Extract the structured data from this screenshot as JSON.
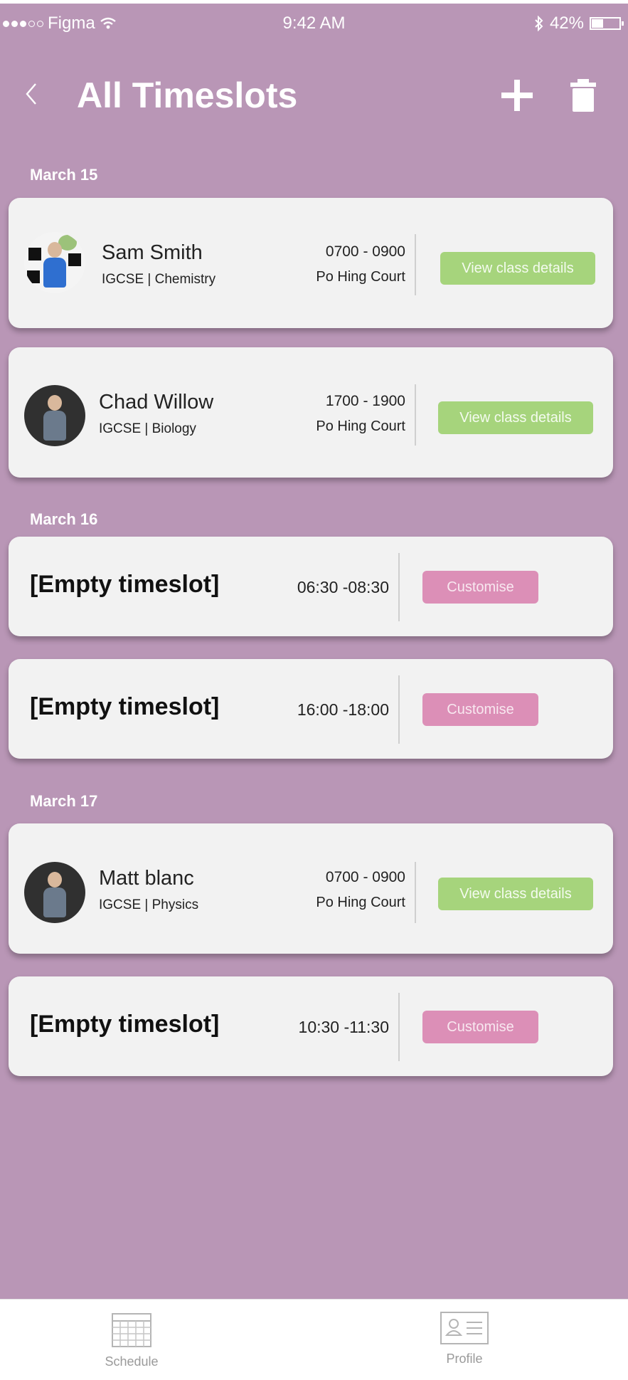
{
  "status_bar": {
    "carrier": "Figma",
    "time": "9:42 AM",
    "battery": "42%"
  },
  "header": {
    "title": "All Timeslots"
  },
  "icons": {
    "back": "chevron-left-icon",
    "add": "plus-icon",
    "delete": "trash-icon",
    "wifi": "wifi-icon",
    "bluetooth": "bluetooth-icon",
    "schedule": "calendar-icon",
    "profile": "profile-card-icon"
  },
  "colors": {
    "background": "#b996b6",
    "card": "#f2f2f2",
    "view_button": "#a6d47c",
    "customise_button": "#dc8fb7"
  },
  "groups": [
    {
      "date": "March 15",
      "slots": [
        {
          "name": "Sam Smith",
          "subject": "IGCSE | Chemistry",
          "time": "0700 - 0900",
          "location": "Po Hing Court",
          "button": "View class details"
        },
        {
          "name": "Chad Willow",
          "subject": "IGCSE | Biology",
          "time": "1700 - 1900",
          "location": "Po Hing Court",
          "button": "View class details"
        }
      ]
    },
    {
      "date": "March 16",
      "slots": [
        {
          "label": "[Empty timeslot]",
          "time": "06:30 -08:30",
          "button": "Customise"
        },
        {
          "label": "[Empty timeslot]",
          "time": "16:00 -18:00",
          "button": "Customise"
        }
      ]
    },
    {
      "date": "March 17",
      "slots": [
        {
          "name": "Matt blanc",
          "subject": "IGCSE | Physics",
          "time": "0700 - 0900",
          "location": "Po Hing Court",
          "button": "View class details"
        },
        {
          "label": "[Empty timeslot]",
          "time": "10:30 -11:30",
          "button": "Customise"
        }
      ]
    }
  ],
  "tabbar": {
    "schedule": "Schedule",
    "profile": "Profile"
  }
}
